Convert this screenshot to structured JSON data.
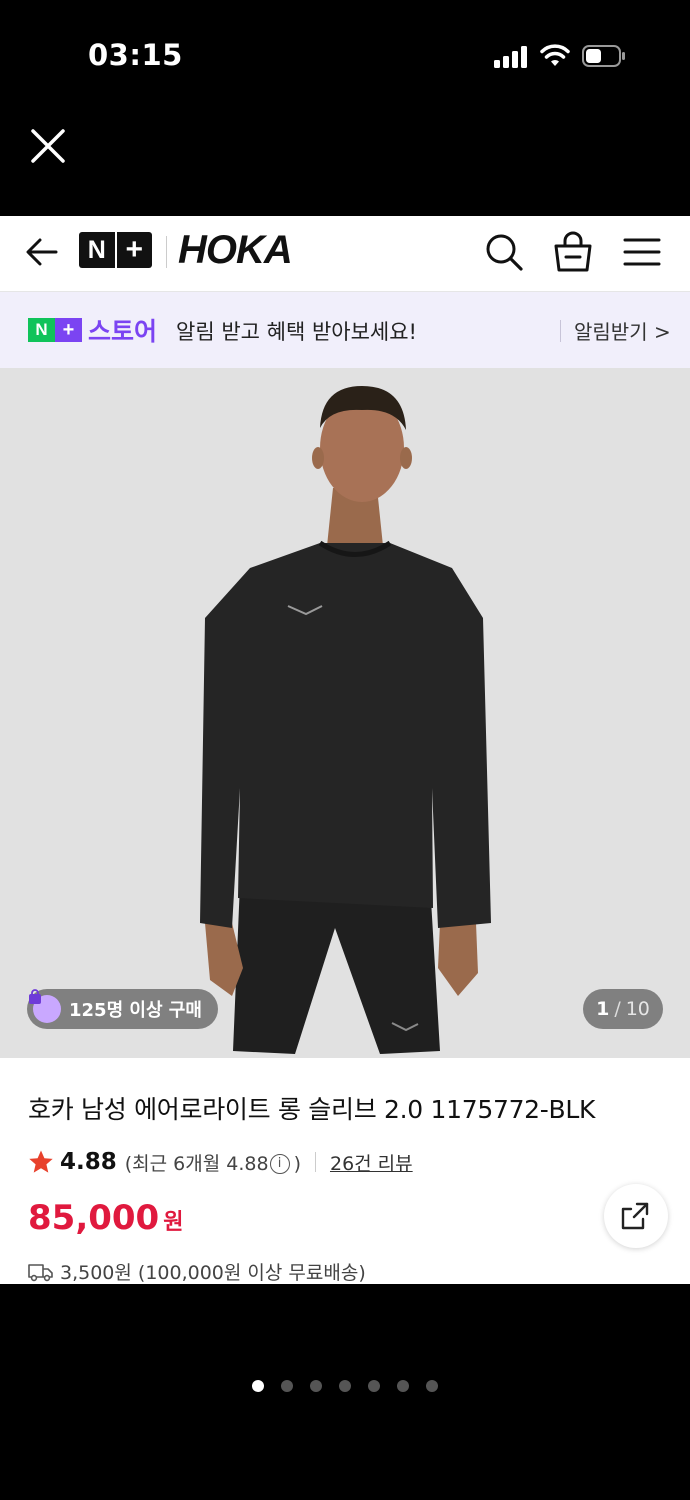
{
  "status_bar": {
    "time": "03:15"
  },
  "navbar": {
    "nplus_n": "N",
    "nplus_plus": "+",
    "brand": "HOKA"
  },
  "promo": {
    "logo_n": "N",
    "logo_plus": "+",
    "store_label": "스토어",
    "message": "알림 받고 혜택 받아보세요!",
    "action": "알림받기 >"
  },
  "hero": {
    "buyer_badge": "125명 이상 구매",
    "counter_current": "1",
    "counter_sep": "/",
    "counter_total": "10"
  },
  "product": {
    "title": "호카 남성 에어로라이트 롱 슬리브 2.0 1175772-BLK",
    "rating": "4.88",
    "rating_recent_prefix": "(최근 6개월 4.88",
    "rating_recent_suffix": ")",
    "info_glyph": "i",
    "review_link": "26건 리뷰",
    "price": "85,000",
    "price_unit": "원",
    "shipping": "3,500원 (100,000원 이상 무료배송)"
  },
  "colors": {
    "accent_purple": "#7b44f2",
    "naver_green": "#10c35a",
    "price_red": "#e0193e",
    "star_red": "#e8412c"
  },
  "pager": {
    "count": 7,
    "active_index": 0
  }
}
